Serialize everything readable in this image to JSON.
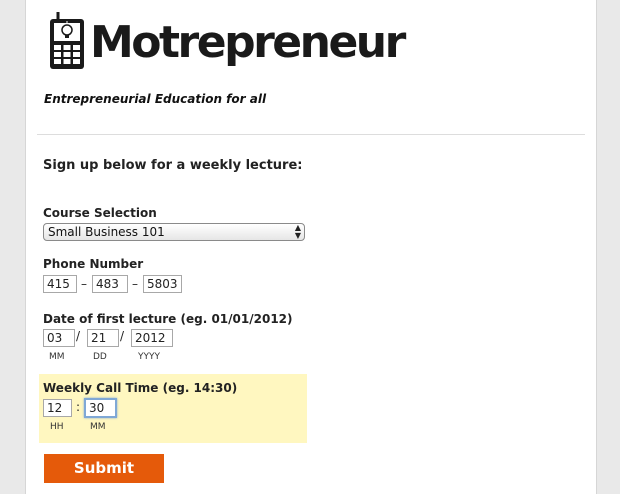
{
  "brand": {
    "name": "Motrepreneur",
    "tagline": "Entrepreneurial Education for all"
  },
  "form": {
    "heading": "Sign up below for a weekly lecture:",
    "course": {
      "label": "Course Selection",
      "selected": "Small Business 101"
    },
    "phone": {
      "label": "Phone Number",
      "area": "415",
      "prefix": "483",
      "line": "5803",
      "separator": "–"
    },
    "date": {
      "label": "Date of first lecture (eg. 01/01/2012)",
      "month": "03",
      "day": "21",
      "year": "2012",
      "separator": "/",
      "month_hint": "MM",
      "day_hint": "DD",
      "year_hint": "YYYY"
    },
    "call_time": {
      "label": "Weekly Call Time (eg. 14:30)",
      "hour": "12",
      "minute": "30",
      "separator": ":",
      "hour_hint": "HH",
      "minute_hint": "MM",
      "highlight_color": "#fff7c0"
    },
    "submit_label": "Submit"
  },
  "colors": {
    "accent": "#e55a0a",
    "focus": "#7fa8d6"
  }
}
